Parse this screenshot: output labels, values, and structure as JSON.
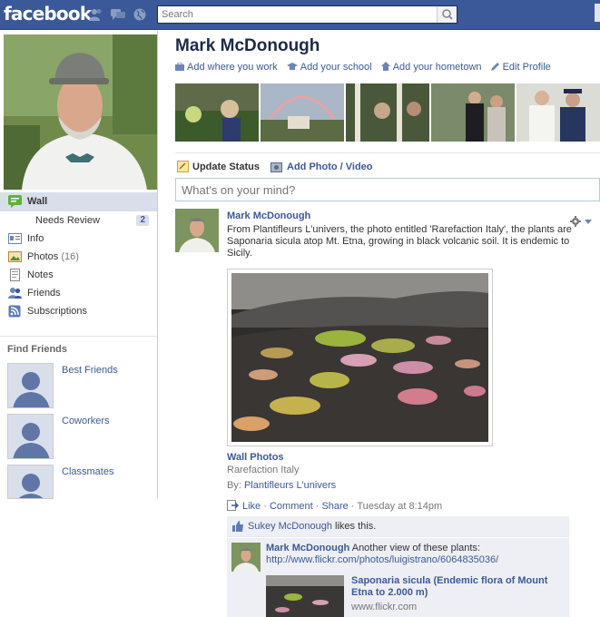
{
  "topbar": {
    "logo": "facebook",
    "search_placeholder": "Search"
  },
  "sidebar": {
    "items": [
      {
        "label": "Wall"
      },
      {
        "label": "Needs Review",
        "badge": "2"
      },
      {
        "label": "Info"
      },
      {
        "label": "Photos",
        "count": "(16)"
      },
      {
        "label": "Notes"
      },
      {
        "label": "Friends"
      },
      {
        "label": "Subscriptions"
      }
    ],
    "find_friends": {
      "title": "Find Friends",
      "items": [
        {
          "label": "Best Friends"
        },
        {
          "label": "Coworkers"
        },
        {
          "label": "Classmates"
        }
      ]
    }
  },
  "profile": {
    "name": "Mark McDonough",
    "links": [
      {
        "label": "Add where you work",
        "icon": "briefcase-icon"
      },
      {
        "label": "Add your school",
        "icon": "graduation-cap-icon"
      },
      {
        "label": "Add your hometown",
        "icon": "house-icon"
      },
      {
        "label": "Edit Profile",
        "icon": "pencil-icon"
      }
    ]
  },
  "composer": {
    "update_status": "Update Status",
    "add_photo": "Add Photo / Video",
    "placeholder": "What's on your mind?"
  },
  "story": {
    "author": "Mark McDonough",
    "text": "From Plantifleurs L'univers, the photo entitled 'Rarefaction Italy', the plants are Saponaria sicula atop Mt. Etna, growing in black volcanic soil. It is endemic to Sicily.",
    "album_title": "Wall Photos",
    "caption": "Rarefaction Italy",
    "by_label": "By:",
    "by_name": "Plantifleurs L'univers",
    "actions": {
      "like": "Like",
      "sep": " · ",
      "comment": "Comment",
      "share": "Share",
      "time": "Tuesday at 8:14pm"
    },
    "likes": {
      "name": "Sukey McDonough",
      "text": " likes this."
    },
    "comment": {
      "author": "Mark McDonough",
      "text": " Another view of these plants:",
      "url": "http://www.flickr.com/photos/luigistrano/6064835036/",
      "share_title": "Saponaria sicula (Endemic flora of Mount Etna to 2.000 m)",
      "share_url": "www.flickr.com"
    }
  },
  "colors": {
    "brand": "#3b5998",
    "nav_active": "#d8dfea",
    "ufi_bg": "#edeff4"
  }
}
